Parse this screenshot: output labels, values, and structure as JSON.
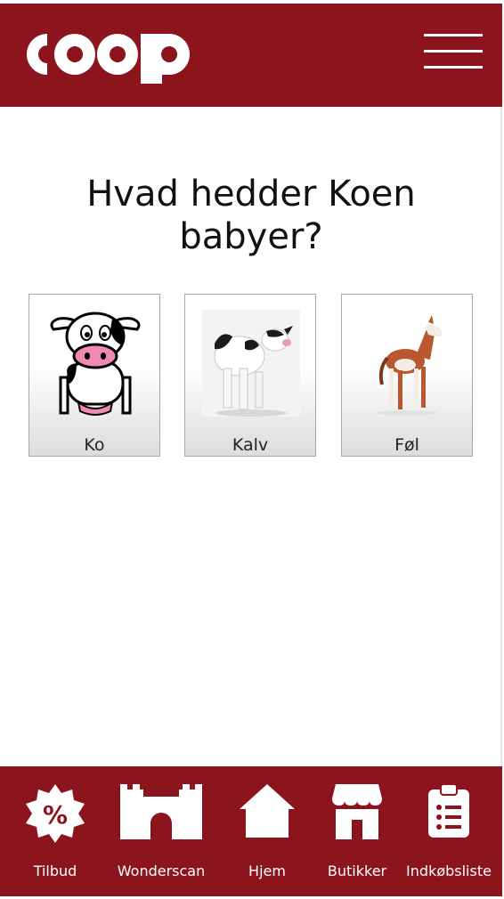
{
  "colors": {
    "brand": "#8c141d",
    "background": "#ffffff",
    "title": "#111111"
  },
  "header": {
    "logo_text": "coop",
    "menu_icon": "hamburger-icon"
  },
  "quiz": {
    "question": "Hvad hedder Koen babyer?",
    "options": [
      {
        "label": "Ko",
        "image": "cartoon-cow"
      },
      {
        "label": "Kalv",
        "image": "calf-photo"
      },
      {
        "label": "Føl",
        "image": "foal-photo"
      }
    ]
  },
  "nav": {
    "items": [
      {
        "label": "Tilbud",
        "icon": "percent-badge-icon"
      },
      {
        "label": "Wonderscan",
        "icon": "castle-icon"
      },
      {
        "label": "Hjem",
        "icon": "home-icon"
      },
      {
        "label": "Butikker",
        "icon": "store-icon"
      },
      {
        "label": "Indkøbsliste",
        "icon": "clipboard-list-icon"
      }
    ]
  }
}
